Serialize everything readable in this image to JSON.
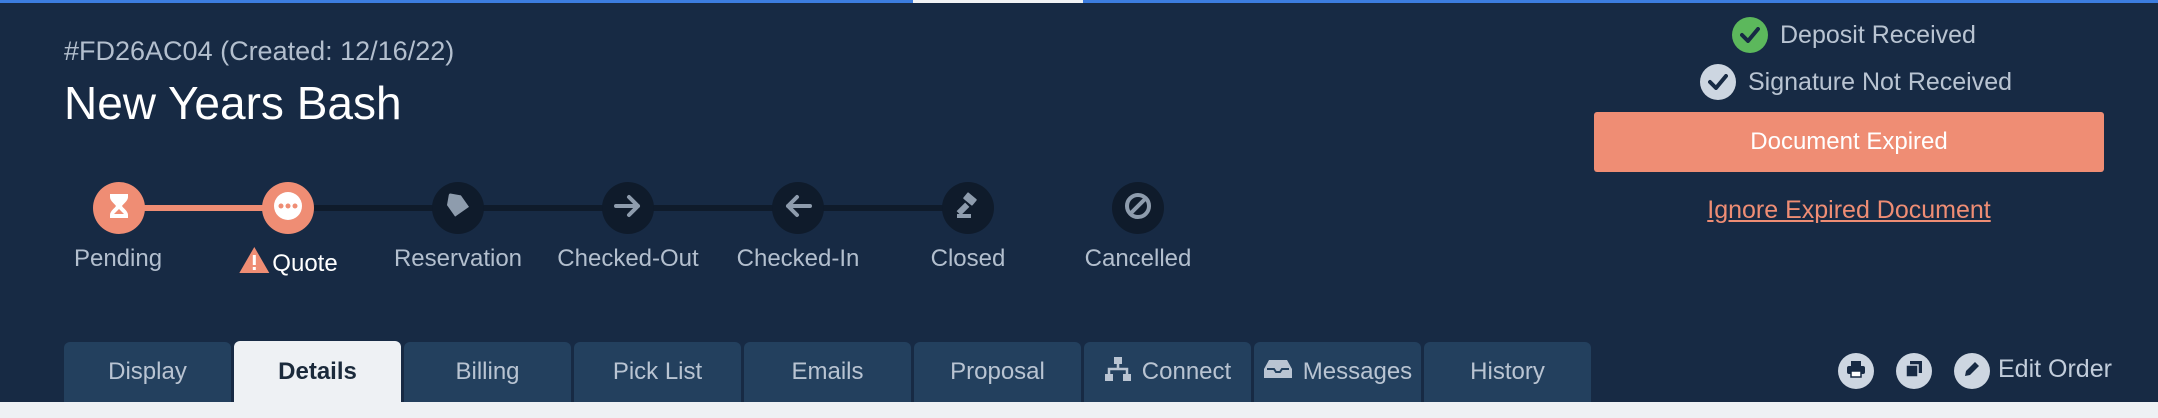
{
  "order": {
    "id_line": "#FD26AC04 (Created: 12/16/22)",
    "title": "New Years Bash"
  },
  "pipeline": {
    "steps": [
      {
        "label": "Pending",
        "icon": "hourglass-icon",
        "state": "done"
      },
      {
        "label": "Quote",
        "icon": "ellipsis-icon",
        "state": "current",
        "warning_icon": "warning-triangle-icon"
      },
      {
        "label": "Reservation",
        "icon": "tag-icon",
        "state": "upcoming"
      },
      {
        "label": "Checked-Out",
        "icon": "arrow-right-icon",
        "state": "upcoming"
      },
      {
        "label": "Checked-In",
        "icon": "arrow-left-icon",
        "state": "upcoming"
      },
      {
        "label": "Closed",
        "icon": "gavel-icon",
        "state": "upcoming"
      },
      {
        "label": "Cancelled",
        "icon": "ban-icon",
        "state": "upcoming"
      }
    ]
  },
  "status": {
    "deposit": {
      "label": "Deposit Received",
      "color": "#5cb85c"
    },
    "signature": {
      "label": "Signature Not Received",
      "color": "#cdd6e1"
    },
    "expired_button": "Document Expired",
    "ignore_link": "Ignore Expired Document"
  },
  "tabs": [
    {
      "label": "Display"
    },
    {
      "label": "Details",
      "active": true
    },
    {
      "label": "Billing"
    },
    {
      "label": "Pick List"
    },
    {
      "label": "Emails"
    },
    {
      "label": "Proposal"
    },
    {
      "label": "Connect",
      "icon": "sitemap-icon"
    },
    {
      "label": "Messages",
      "icon": "inbox-icon"
    },
    {
      "label": "History"
    }
  ],
  "toolbar": {
    "print_icon": "print-icon",
    "copy_icon": "copy-icon",
    "edit_icon": "pencil-icon",
    "edit_label": "Edit Order"
  },
  "colors": {
    "background": "#172a44",
    "accent": "#ef8d74",
    "tab": "#23405e",
    "tab_active": "#eef1f4"
  }
}
